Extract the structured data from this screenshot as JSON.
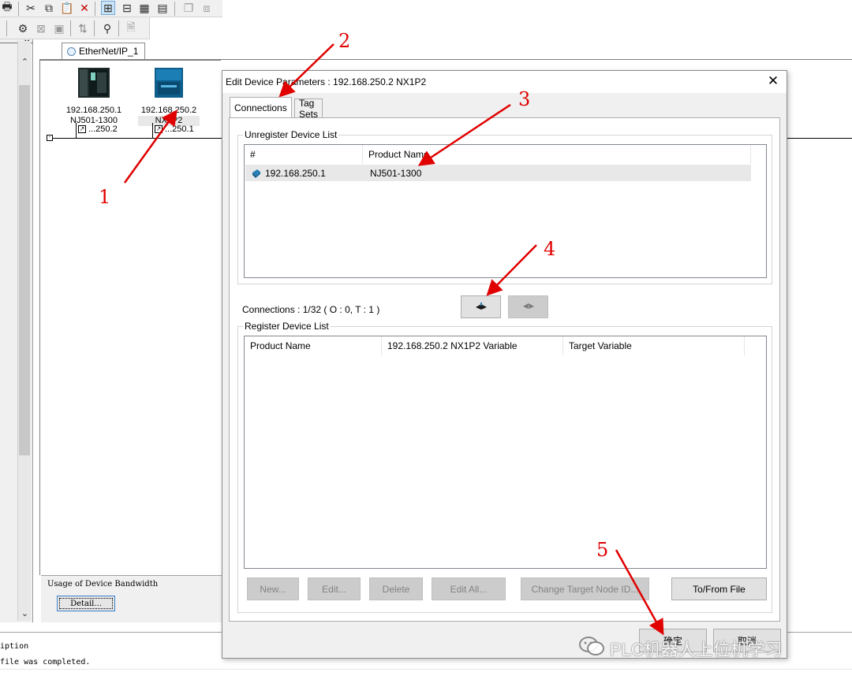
{
  "network_tab": {
    "label": "EtherNet/IP_1"
  },
  "devices": [
    {
      "ip": "192.168.250.1",
      "model": "NJ501-1300",
      "node": "...250.2"
    },
    {
      "ip": "192.168.250.2",
      "model": "NX1P2",
      "node": "...250.1"
    }
  ],
  "bandwidth": {
    "label": "Usage of Device Bandwidth",
    "detail_button": "Detail..."
  },
  "output": {
    "lines": [
      "iption",
      "file was completed."
    ]
  },
  "dialog": {
    "title": "Edit Device Parameters : 192.168.250.2 NX1P2",
    "tabs": [
      "Connections",
      "Tag Sets"
    ],
    "unregister": {
      "label": "Unregister Device List",
      "columns": [
        "#",
        "Product Name"
      ],
      "rows": [
        {
          "id": "192.168.250.1",
          "product": "NJ501-1300"
        }
      ]
    },
    "connections_text": "Connections :   1/32 ( O : 0, T : 1 )",
    "register": {
      "label": "Register Device List",
      "columns": [
        "Product Name",
        "192.168.250.2 NX1P2 Variable",
        "Target Variable"
      ]
    },
    "buttons": {
      "new": "New...",
      "edit": "Edit...",
      "delete": "Delete",
      "edit_all": "Edit All...",
      "change_target": "Change Target Node ID...",
      "to_from_file": "To/From File",
      "ok": "确定",
      "cancel": "取消"
    }
  },
  "watermark": "PLC机器人上位机学习",
  "annotations": [
    "1",
    "2",
    "3",
    "4",
    "5"
  ],
  "colors": {
    "annotation": "#e00000",
    "accent": "#3c7fd0"
  }
}
